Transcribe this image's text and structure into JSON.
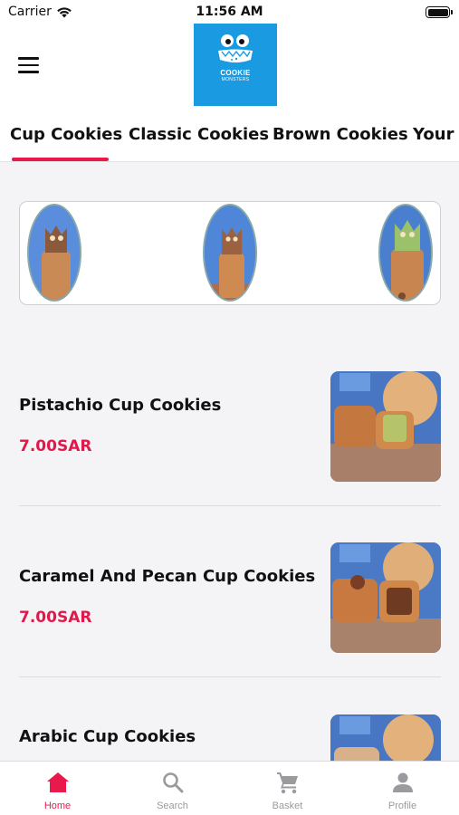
{
  "status_bar": {
    "carrier": "Carrier",
    "time": "11:56 AM"
  },
  "header": {
    "logo_text_line1": "COOKIE",
    "logo_text_line2": "MONSTERS"
  },
  "tabs": [
    {
      "label": "Cup Cookies",
      "active": true
    },
    {
      "label": "Classic Cookies",
      "active": false
    },
    {
      "label": "Brown Cookies",
      "active": false
    },
    {
      "label": "Your C",
      "active": false
    }
  ],
  "products": [
    {
      "name": "Pistachio Cup Cookies",
      "price": "7.00SAR",
      "image": "pistachio-cup-cookie-photo"
    },
    {
      "name": "Caramel And Pecan Cup Cookies",
      "price": "7.00SAR",
      "image": "caramel-pecan-cup-cookie-photo"
    },
    {
      "name": "Arabic Cup Cookies",
      "price": "",
      "image": "arabic-cup-cookie-photo"
    }
  ],
  "bottom_nav": [
    {
      "label": "Home",
      "icon": "home-icon",
      "active": true
    },
    {
      "label": "Search",
      "icon": "search-icon",
      "active": false
    },
    {
      "label": "Basket",
      "icon": "cart-icon",
      "active": false
    },
    {
      "label": "Profile",
      "icon": "person-icon",
      "active": false
    }
  ],
  "colors": {
    "accent": "#e8194b",
    "logo_background": "#1a9ae0",
    "inactive_nav": "#9a9a9f"
  }
}
